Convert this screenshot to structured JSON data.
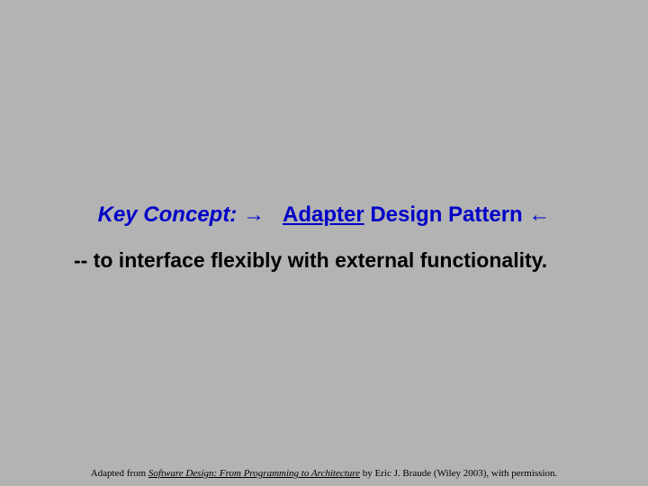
{
  "title": {
    "key_concept": "Key Concept:",
    "arrow_right": "→",
    "adapter": "Adapter",
    "rest": "Design Pattern",
    "arrow_left": "←"
  },
  "body": "-- to interface flexibly with external functionality.",
  "footer": {
    "prefix": "Adapted from ",
    "book": "Software Design: From Programming to Architecture",
    "suffix": " by Eric J. Braude (Wiley 2003), with permission."
  }
}
